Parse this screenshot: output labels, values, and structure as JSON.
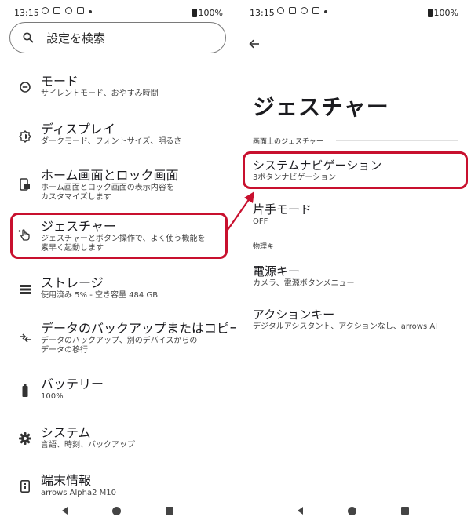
{
  "status_bar": {
    "time": "13:15",
    "battery": "100%"
  },
  "left": {
    "search_placeholder": "設定を検索",
    "items": [
      {
        "title": "モード",
        "subtitle": "サイレントモード、おやすみ時間",
        "icon": "mode-icon"
      },
      {
        "title": "ディスプレイ",
        "subtitle": "ダークモード、フォントサイズ、明るさ",
        "icon": "display-icon"
      },
      {
        "title": "ホーム画面とロック画面",
        "subtitle": "ホーム画面とロック画面の表示内容を\nカスタマイズします",
        "icon": "home-lock-icon"
      },
      {
        "title": "ジェスチャー",
        "subtitle": "ジェスチャーとボタン操作で、よく使う機能を\n素早く起動します",
        "icon": "gesture-icon"
      },
      {
        "title": "ストレージ",
        "subtitle": "使用済み 5% - 空き容量 484 GB",
        "icon": "storage-icon"
      },
      {
        "title": "データのバックアップまたはコピー",
        "subtitle": "データのバックアップ、別のデバイスからの\nデータの移行",
        "icon": "backup-icon"
      },
      {
        "title": "バッテリー",
        "subtitle": "100%",
        "icon": "battery-icon"
      },
      {
        "title": "システム",
        "subtitle": "言語、時刻、バックアップ",
        "icon": "system-gear-icon"
      },
      {
        "title": "端末情報",
        "subtitle": "arrows Alpha2 M10",
        "icon": "device-info-icon"
      }
    ]
  },
  "right": {
    "title": "ジェスチャー",
    "section1": "画面上のジェスチャー",
    "section2": "物理キー",
    "items": [
      {
        "title": "システムナビゲーション",
        "subtitle": "3ボタンナビゲーション"
      },
      {
        "title": "片手モード",
        "subtitle": "OFF"
      },
      {
        "title": "電源キー",
        "subtitle": "カメラ、電源ボタンメニュー"
      },
      {
        "title": "アクションキー",
        "subtitle": "デジタルアシスタント、アクションなし、arrows AI"
      }
    ]
  },
  "colors": {
    "highlight": "#c8102e",
    "text": "#1b1b1f"
  }
}
